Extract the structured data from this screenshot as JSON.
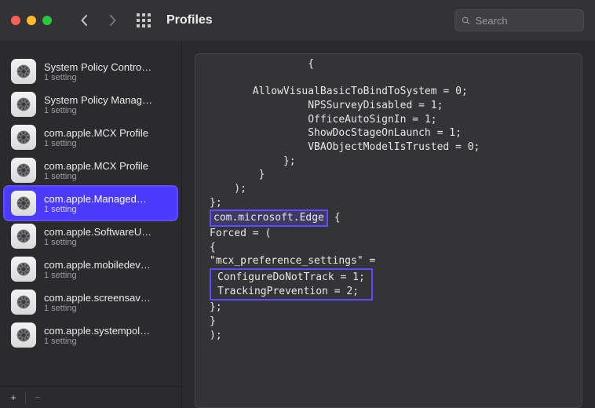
{
  "header": {
    "title": "Profiles",
    "search_placeholder": "Search"
  },
  "sidebar": {
    "items": [
      {
        "name": "System Policy Contro…",
        "sub": "1 setting"
      },
      {
        "name": "System Policy Manag…",
        "sub": "1 setting"
      },
      {
        "name": "com.apple.MCX Profile",
        "sub": "1 setting"
      },
      {
        "name": "com.apple.MCX Profile",
        "sub": "1 setting"
      },
      {
        "name": "com.apple.Managed…",
        "sub": "1 setting",
        "selected": true
      },
      {
        "name": "com.apple.SoftwareU…",
        "sub": "1 setting"
      },
      {
        "name": "com.apple.mobiledev…",
        "sub": "1 setting"
      },
      {
        "name": "com.apple.screensav…",
        "sub": "1 setting"
      },
      {
        "name": "com.apple.systempol…",
        "sub": "1 setting"
      }
    ],
    "add_label": "+",
    "remove_label": "−"
  },
  "detail": {
    "pre_lines": [
      "                {",
      "",
      "       AllowVisualBasicToBindToSystem = 0;",
      "                NPSSurveyDisabled = 1;",
      "                OfficeAutoSignIn = 1;",
      "                ShowDocStageOnLaunch = 1;",
      "                VBAObjectModelIsTrusted = 0;",
      "            };",
      "        }",
      "    );",
      "};"
    ],
    "edge_key": "com.microsoft.Edge",
    "edge_open": " {",
    "forced_line": "    Forced =     (",
    "mcx_open": "                {",
    "mcx_line": "            \"mcx_preference_settings\" =",
    "box2_l1": "ConfigureDoNotTrack = 1;",
    "box2_l2": "TrackingPrevention = 2;",
    "close1": "            };",
    "close2": "        }",
    "close3": "    );"
  }
}
